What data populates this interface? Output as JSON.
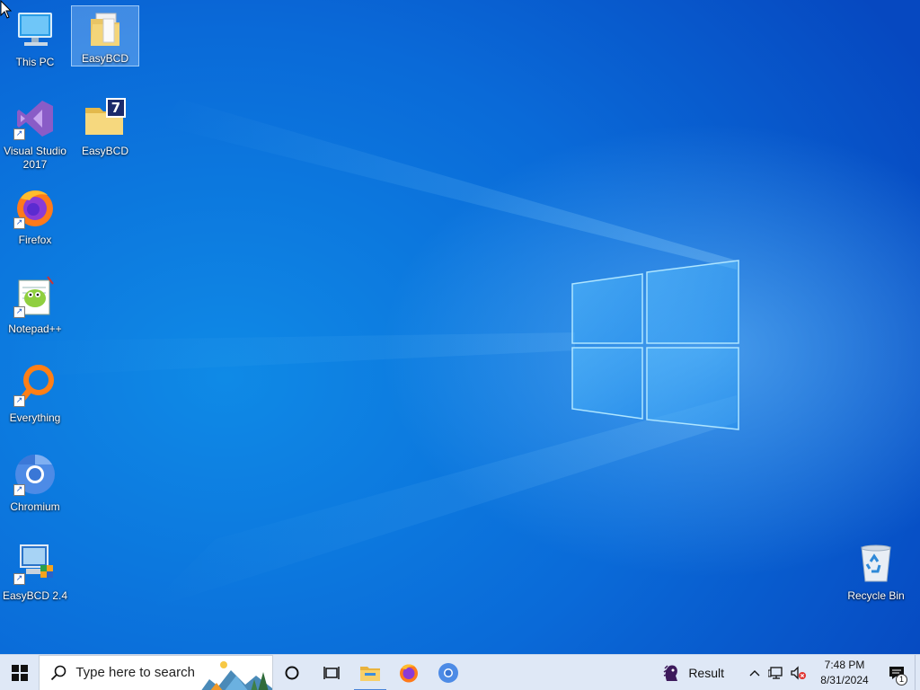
{
  "desktop": {
    "icons": [
      {
        "label": "This PC",
        "icon": "this-pc-icon",
        "selected": false
      },
      {
        "label": "EasyBCD",
        "icon": "folder-icon",
        "selected": true
      },
      {
        "label": "Visual Studio 2017",
        "icon": "visual-studio-icon",
        "selected": false
      },
      {
        "label": "EasyBCD",
        "icon": "easybcd-folder-icon",
        "selected": false
      },
      {
        "label": "Firefox",
        "icon": "firefox-icon",
        "selected": false
      },
      {
        "label": "Notepad++",
        "icon": "notepadpp-icon",
        "selected": false
      },
      {
        "label": "Everything",
        "icon": "everything-icon",
        "selected": false
      },
      {
        "label": "Chromium",
        "icon": "chromium-icon",
        "selected": false
      },
      {
        "label": "EasyBCD 2.4",
        "icon": "easybcd-app-icon",
        "selected": false
      },
      {
        "label": "Recycle Bin",
        "icon": "recycle-bin-icon",
        "selected": false
      }
    ]
  },
  "taskbar": {
    "search_placeholder": "Type here to search",
    "pinned": [
      {
        "icon": "cortana-icon"
      },
      {
        "icon": "task-view-icon"
      },
      {
        "icon": "file-explorer-icon",
        "active": true
      },
      {
        "icon": "firefox-icon"
      },
      {
        "icon": "chromium-icon"
      }
    ],
    "weather_label": "Result",
    "clock": {
      "time": "7:48 PM",
      "date": "8/31/2024"
    },
    "notification_count": "1"
  },
  "colors": {
    "taskbar_bg": "#dfe8f6",
    "accent": "#4a86d8",
    "wallpaper_blue": "#0a6ad8"
  }
}
